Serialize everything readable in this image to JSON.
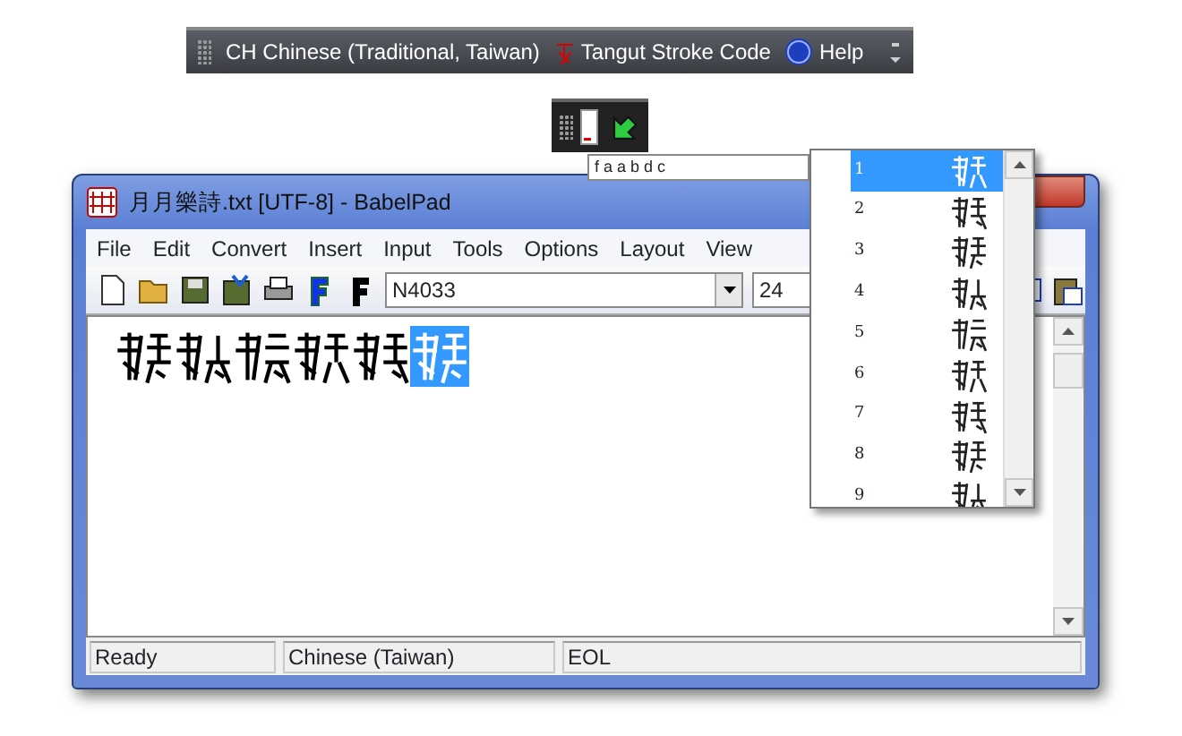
{
  "language_bar": {
    "language": "CH Chinese (Traditional, Taiwan)",
    "input_method": "Tangut Stroke Code",
    "help": "Help"
  },
  "composition": {
    "text": "f a a b d c"
  },
  "candidates": [
    {
      "number": "1",
      "selected": true
    },
    {
      "number": "2",
      "selected": false
    },
    {
      "number": "3",
      "selected": false
    },
    {
      "number": "4",
      "selected": false
    },
    {
      "number": "5",
      "selected": false
    },
    {
      "number": "6",
      "selected": false
    },
    {
      "number": "7",
      "selected": false
    },
    {
      "number": "8",
      "selected": false
    },
    {
      "number": "9",
      "selected": false
    }
  ],
  "window": {
    "title": "月月樂詩.txt [UTF-8] - BabelPad",
    "menu": [
      "File",
      "Edit",
      "Convert",
      "Insert",
      "Input",
      "Tools",
      "Options",
      "Layout",
      "View"
    ],
    "toolbar": {
      "font": "N4033",
      "size": "24"
    },
    "document": {
      "glyphs": [
        {
          "selected": false
        },
        {
          "selected": false
        },
        {
          "selected": false
        },
        {
          "selected": false
        },
        {
          "selected": false
        },
        {
          "selected": true
        }
      ]
    },
    "status_bar": [
      "Ready",
      "Chinese (Taiwan)",
      "EOL"
    ]
  }
}
